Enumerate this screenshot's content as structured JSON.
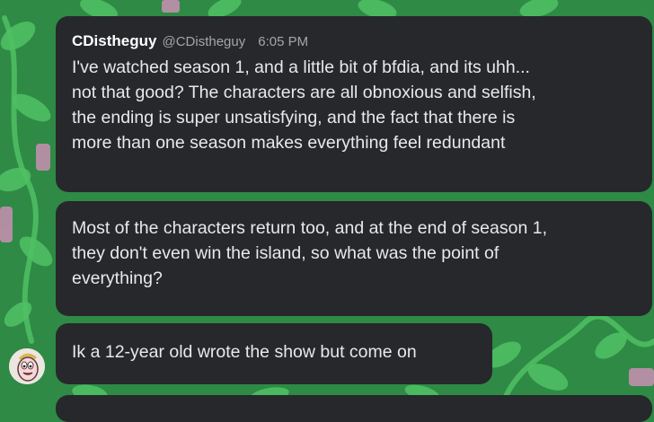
{
  "theme": {
    "bubble_bg": "#26282b",
    "text_color": "#e8e9ea",
    "muted_color": "#a3a6aa",
    "background_green": "#2e8a45",
    "background_leaf": "#4fbf63",
    "background_pink": "#c98fb4"
  },
  "background": {
    "icon": "leaf-vine-pattern"
  },
  "avatar": {
    "icon": "cartoon-character-avatar"
  },
  "messages": [
    {
      "author": "CDistheguy",
      "handle": "@CDistheguy",
      "time": "6:05 PM",
      "lines": [
        "I've watched season 1, and a little bit of bfdia, and its uhh...",
        "not that good? The characters are all obnoxious and selfish,",
        "the ending is super unsatisfying, and the fact that there is",
        "more than one season makes everything feel redundant"
      ]
    },
    {
      "lines": [
        "Most of the characters return too, and at the end of season 1,",
        "they don't even win the island, so what was the point of",
        "everything?"
      ]
    },
    {
      "lines": [
        "Ik a 12-year old wrote the show but come on"
      ]
    }
  ]
}
